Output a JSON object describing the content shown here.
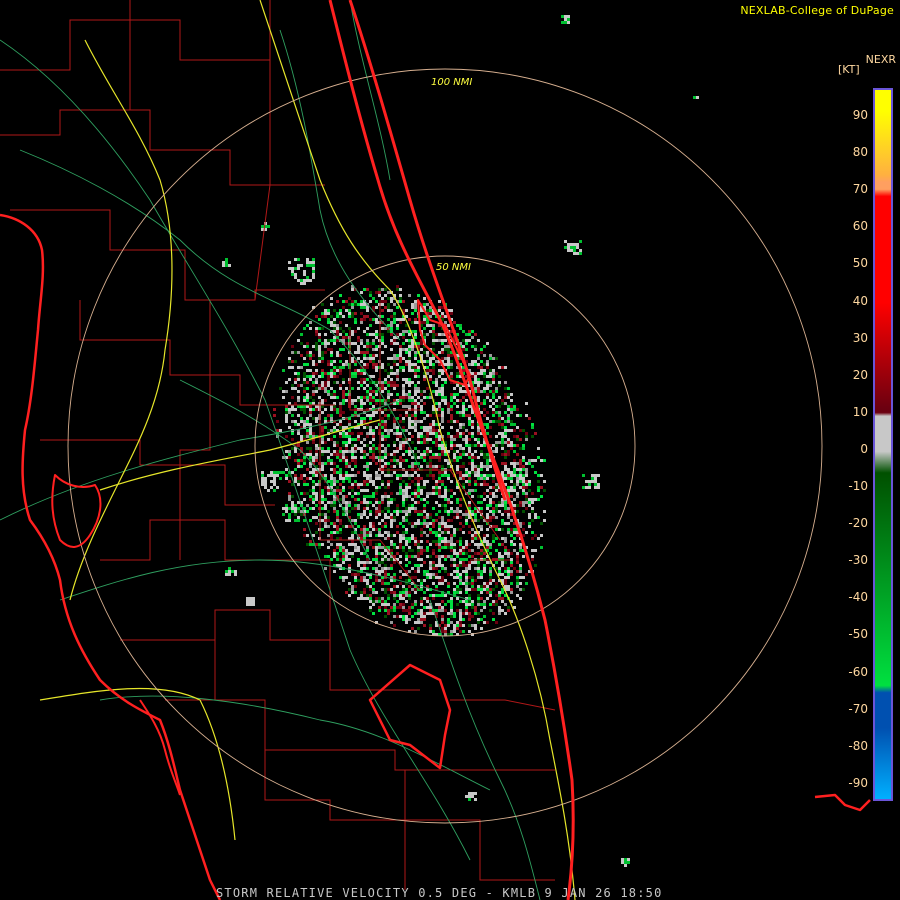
{
  "credit": "NEXLAB-College of DuPage",
  "product_code": "NEXR",
  "units": "[KT]",
  "footer": "STORM RELATIVE VELOCITY 0.5 DEG - KMLB 9 JAN 26 18:50",
  "range_rings": [
    {
      "label": "50 NMI",
      "nmi": 50
    },
    {
      "label": "100 NMI",
      "nmi": 100
    }
  ],
  "legend": {
    "ticks": [
      "90",
      "80",
      "70",
      "60",
      "50",
      "40",
      "30",
      "20",
      "10",
      "0",
      "-10",
      "-20",
      "-30",
      "-40",
      "-50",
      "-60",
      "-70",
      "-80",
      "-90"
    ],
    "colors": {
      "high": "#ffff00",
      "orange": "#ff9f60",
      "red": "#ff0000",
      "darkred": "#6b0010",
      "gray": "#c8c8c8",
      "green": "#00e040",
      "darkgreen": "#005000",
      "blue": "#0050b0",
      "cyan": "#00b0ff"
    }
  },
  "map_colors": {
    "background": "#000000",
    "coast": "#ff2020",
    "counties": "#b01818",
    "roads": "#2fa060",
    "interstates": "#e6e62a",
    "rings": "#d8b090"
  }
}
